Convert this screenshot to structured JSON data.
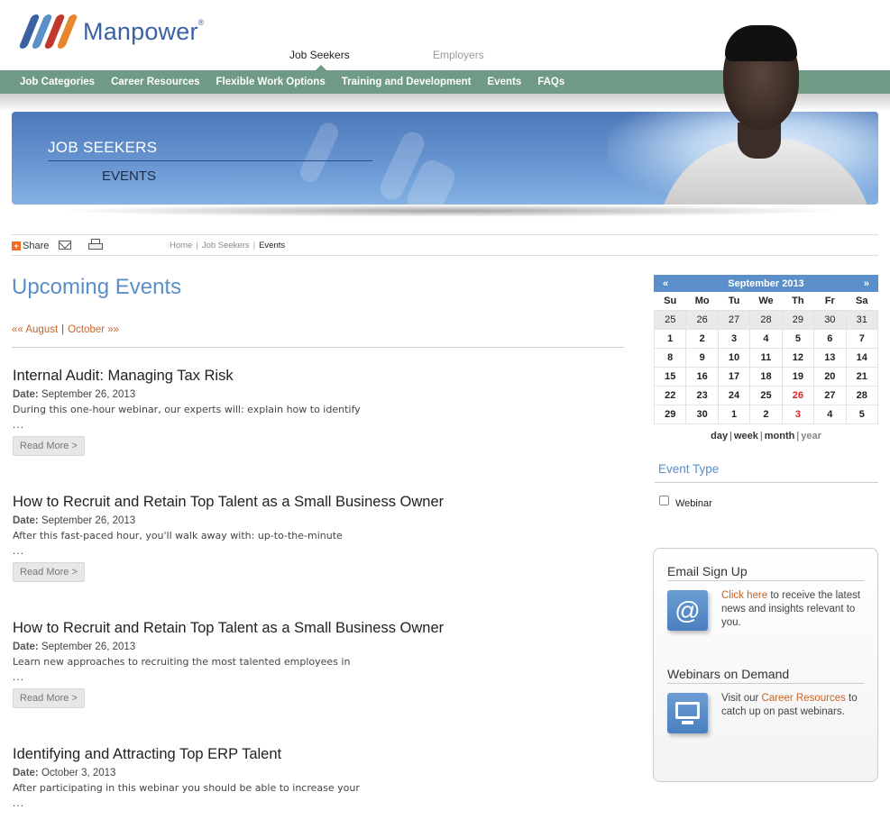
{
  "header": {
    "brand": "Manpower",
    "brand_mark": "®",
    "tabs": [
      {
        "label": "Job Seekers",
        "active": true
      },
      {
        "label": "Employers",
        "active": false
      }
    ]
  },
  "nav": {
    "items": [
      "Job Categories",
      "Career Resources",
      "Flexible Work Options",
      "Training and Development",
      "Events",
      "FAQs"
    ]
  },
  "banner": {
    "title": "JOB SEEKERS",
    "subtitle": "EVENTS"
  },
  "toolbar": {
    "share_label": "Share",
    "breadcrumb": [
      "Home",
      "Job Seekers",
      "Events"
    ]
  },
  "main": {
    "title": "Upcoming Events",
    "prev_month": "«« August",
    "next_month": "October »»",
    "events": [
      {
        "title": "Internal Audit: Managing Tax Risk",
        "date_label": "Date:",
        "date": "September 26, 2013",
        "desc": "During this one-hour webinar, our experts will: explain how to identify",
        "ellipsis": "...",
        "read_more": "Read More >"
      },
      {
        "title": "How to Recruit and Retain Top Talent as a Small Business Owner",
        "date_label": "Date:",
        "date": "September 26, 2013",
        "desc": "After this fast-paced hour, you'll walk away with: up-to-the-minute",
        "ellipsis": "...",
        "read_more": "Read More >"
      },
      {
        "title": "How to Recruit and Retain Top Talent as a Small Business Owner",
        "date_label": "Date:",
        "date": "September 26, 2013",
        "desc": "Learn new approaches to recruiting the most talented employees in",
        "ellipsis": "...",
        "read_more": "Read More >"
      },
      {
        "title": "Identifying and Attracting Top ERP Talent",
        "date_label": "Date:",
        "date": "October 3, 2013",
        "desc": "After participating in this webinar you should be able to increase your",
        "ellipsis": "..."
      }
    ]
  },
  "calendar": {
    "prev": "«",
    "next": "»",
    "month_label": "September 2013",
    "weekdays": [
      "Su",
      "Mo",
      "Tu",
      "We",
      "Th",
      "Fr",
      "Sa"
    ],
    "weeks": [
      [
        "25",
        "26",
        "27",
        "28",
        "29",
        "30",
        "31"
      ],
      [
        "1",
        "2",
        "3",
        "4",
        "5",
        "6",
        "7"
      ],
      [
        "8",
        "9",
        "10",
        "11",
        "12",
        "13",
        "14"
      ],
      [
        "15",
        "16",
        "17",
        "18",
        "19",
        "20",
        "21"
      ],
      [
        "22",
        "23",
        "24",
        "25",
        "26",
        "27",
        "28"
      ],
      [
        "29",
        "30",
        "1",
        "2",
        "3",
        "4",
        "5"
      ]
    ],
    "highlight_color": "#dd2222",
    "views": [
      "day",
      "week",
      "month",
      "year"
    ]
  },
  "sidebar": {
    "event_type_title": "Event Type",
    "event_type_option": "Webinar",
    "email_signup": {
      "title": "Email Sign Up",
      "link": "Click here",
      "text": " to receive the latest news and insights relevant to you."
    },
    "webinars": {
      "title": "Webinars on Demand",
      "prefix": "Visit our ",
      "link": "Career Resources",
      "suffix": " to catch up on past webinars."
    }
  },
  "colors": {
    "nav_green": "#6f9a85",
    "accent_blue": "#5a8fc9",
    "link_orange": "#c8642a",
    "brand_blue": "#3a62a0"
  }
}
